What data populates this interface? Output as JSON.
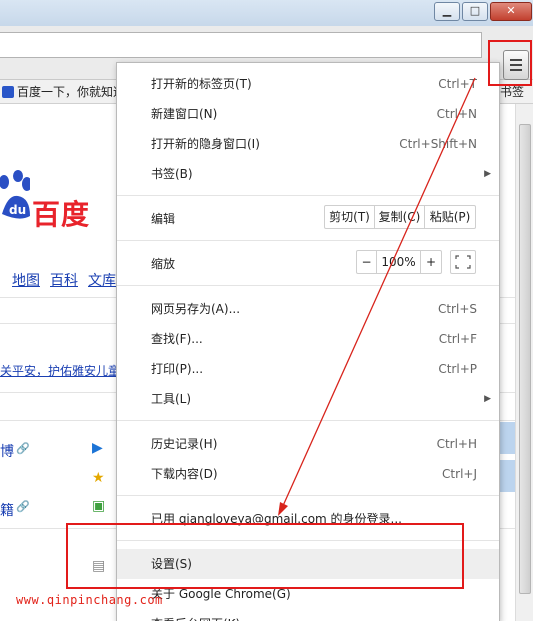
{
  "window": {
    "minimize_glyph": "▁",
    "maximize_glyph": "□",
    "close_glyph": "✕"
  },
  "bookmarks_bar": {
    "item_label": "百度一下，你就知道",
    "right_label": "书签"
  },
  "page": {
    "logo_text": "百度",
    "nav_links": [
      "地图",
      "百科",
      "文库"
    ],
    "news_text": "关平安，护佑雅安儿童",
    "side_texts": [
      "博",
      "籍"
    ]
  },
  "menu": {
    "new_tab": {
      "label": "打开新的标签页(T)",
      "shortcut": "Ctrl+T"
    },
    "new_window": {
      "label": "新建窗口(N)",
      "shortcut": "Ctrl+N"
    },
    "incognito": {
      "label": "打开新的隐身窗口(I)",
      "shortcut": "Ctrl+Shift+N"
    },
    "bookmarks": {
      "label": "书签(B)"
    },
    "edit": {
      "label": "编辑",
      "cut": "剪切(T)",
      "copy": "复制(C)",
      "paste": "粘贴(P)"
    },
    "zoom": {
      "label": "缩放",
      "minus": "−",
      "value": "100%",
      "plus": "+"
    },
    "save_page": {
      "label": "网页另存为(A)...",
      "shortcut": "Ctrl+S"
    },
    "find": {
      "label": "查找(F)...",
      "shortcut": "Ctrl+F"
    },
    "print": {
      "label": "打印(P)...",
      "shortcut": "Ctrl+P"
    },
    "tools": {
      "label": "工具(L)"
    },
    "history": {
      "label": "历史记录(H)",
      "shortcut": "Ctrl+H"
    },
    "downloads": {
      "label": "下载内容(D)",
      "shortcut": "Ctrl+J"
    },
    "signed_in": {
      "label": "已用 qiangloveya@gmail.com 的身份登录..."
    },
    "settings": {
      "label": "设置(S)"
    },
    "about": {
      "label": "关于 Google Chrome(G)"
    },
    "view_bg": {
      "label": "查看后台网页(K)"
    }
  },
  "watermark": "www.qinpinchang.com",
  "colors": {
    "annotation_red": "#e21a1a",
    "highlight": "#eeeeee",
    "link_blue": "#1a3fb2",
    "baidu_red": "#e8232b"
  },
  "icons": [
    "hamburger-menu-icon",
    "submenu-arrow-icon",
    "fullscreen-icon",
    "baidu-paw-icon",
    "bookmark-favicon-icon",
    "link-icon",
    "play-icon",
    "star-icon",
    "document-icon"
  ]
}
